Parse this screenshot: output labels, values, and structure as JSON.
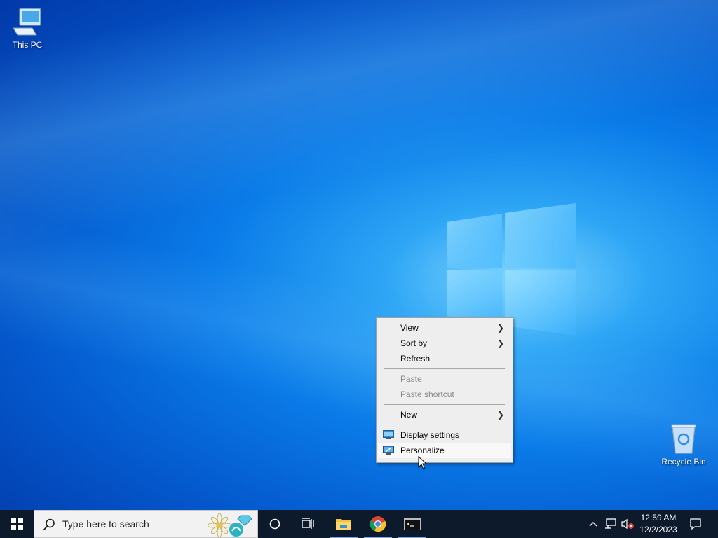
{
  "desktop": {
    "icons": [
      {
        "label": "This PC"
      },
      {
        "label": "Recycle Bin"
      }
    ]
  },
  "context_menu": {
    "items": [
      {
        "label": "View",
        "submenu": true,
        "enabled": true
      },
      {
        "label": "Sort by",
        "submenu": true,
        "enabled": true
      },
      {
        "label": "Refresh",
        "enabled": true
      },
      {
        "label": "Paste",
        "enabled": false
      },
      {
        "label": "Paste shortcut",
        "enabled": false
      },
      {
        "label": "New",
        "submenu": true,
        "enabled": true
      },
      {
        "label": "Display settings",
        "icon": "display-icon",
        "enabled": true
      },
      {
        "label": "Personalize",
        "icon": "personalize-icon",
        "enabled": true,
        "hovered": true
      }
    ]
  },
  "taskbar": {
    "search_placeholder": "Type here to search",
    "apps": [
      {
        "name": "file-explorer-icon",
        "active": true
      },
      {
        "name": "chrome-icon",
        "active": true
      },
      {
        "name": "command-prompt-icon",
        "active": true
      }
    ],
    "clock": {
      "time": "12:59 AM",
      "date": "12/2/2023"
    }
  },
  "colors": {
    "taskbar": "#0d1a2b",
    "menu_bg": "#eeeeee",
    "accent": "#0a7be8"
  }
}
